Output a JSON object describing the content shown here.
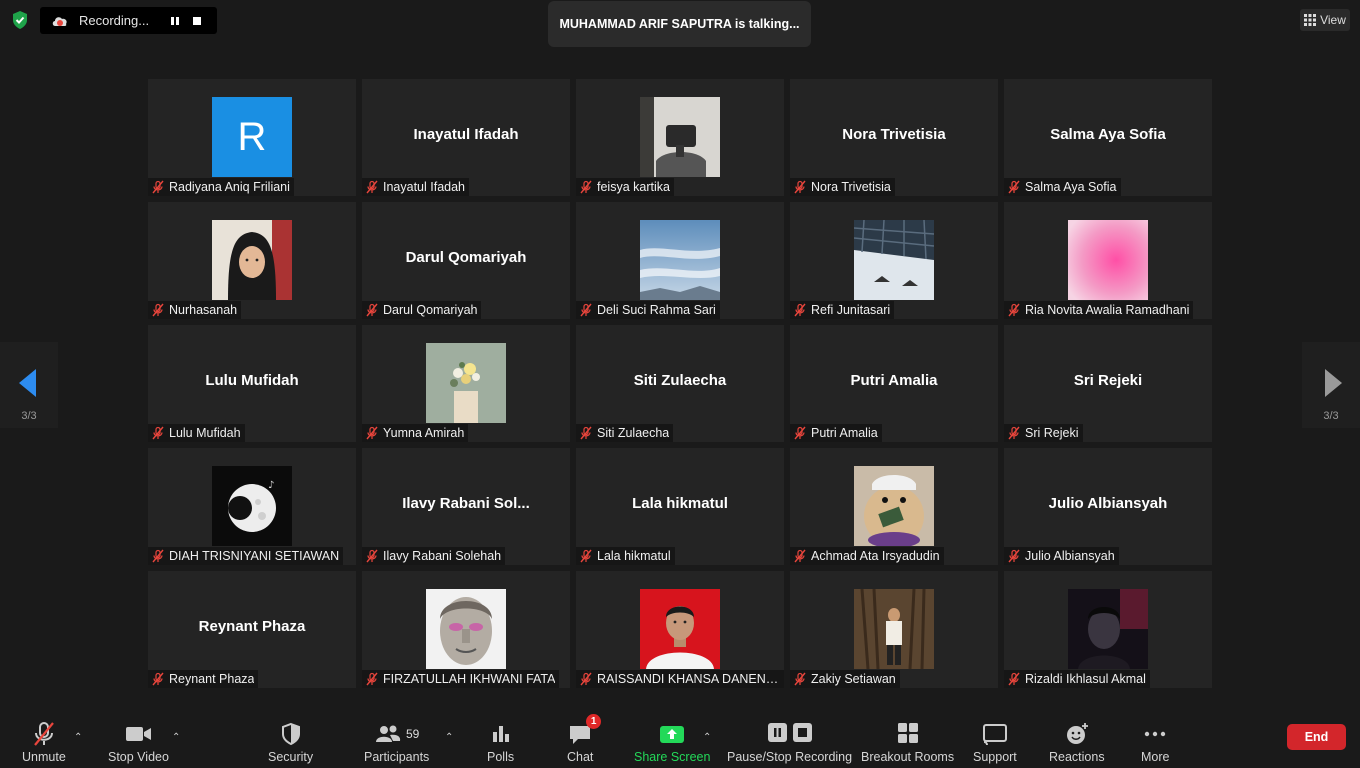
{
  "recording": {
    "label": "Recording..."
  },
  "talking_banner": "MUHAMMAD ARIF SAPUTRA is talking...",
  "view_button": "View",
  "pagination": {
    "left": "3/3",
    "right": "3/3"
  },
  "participants": [
    {
      "name": "Radiyana Aniq Friliani",
      "display": "",
      "avatar": "letter",
      "letter": "R",
      "color": "#1a8fe3"
    },
    {
      "name": "Inayatul Ifadah",
      "display": "Inayatul Ifadah"
    },
    {
      "name": "feisya kartika",
      "display": "",
      "avatar": "photo",
      "scene": "chair"
    },
    {
      "name": "Nora Trivetisia",
      "display": "Nora Trivetisia"
    },
    {
      "name": "Salma Aya Sofia",
      "display": "Salma Aya Sofia"
    },
    {
      "name": "Nurhasanah",
      "display": "",
      "avatar": "photo",
      "scene": "girl"
    },
    {
      "name": "Darul Qomariyah",
      "display": "Darul Qomariyah"
    },
    {
      "name": "Deli Suci Rahma Sari",
      "display": "",
      "avatar": "photo",
      "scene": "sky"
    },
    {
      "name": "Refi Junitasari",
      "display": "",
      "avatar": "photo",
      "scene": "ceiling"
    },
    {
      "name": "Ria Novita Awalia Ramadhani",
      "display": "",
      "avatar": "photo",
      "scene": "pink"
    },
    {
      "name": "Lulu Mufidah",
      "display": "Lulu Mufidah"
    },
    {
      "name": "Yumna Amirah",
      "display": "",
      "avatar": "photo",
      "scene": "flowers"
    },
    {
      "name": "Siti Zulaecha",
      "display": "Siti Zulaecha"
    },
    {
      "name": "Putri Amalia",
      "display": "Putri Amalia"
    },
    {
      "name": "Sri Rejeki",
      "display": "Sri Rejeki"
    },
    {
      "name": "DIAH TRISNIYANI SETIAWAN",
      "display": "",
      "avatar": "photo",
      "scene": "moon"
    },
    {
      "name": "Ilavy Rabani Solehah",
      "display": "Ilavy  Rabani  Sol..."
    },
    {
      "name": "Lala hikmatul",
      "display": "Lala hikmatul"
    },
    {
      "name": "Achmad Ata Irsyadudin",
      "display": "",
      "avatar": "photo",
      "scene": "hamster"
    },
    {
      "name": "Julio Albiansyah",
      "display": "Julio Albiansyah"
    },
    {
      "name": "Reynant Phaza",
      "display": "Reynant Phaza"
    },
    {
      "name": "FIRZATULLAH IKHWANI FATA",
      "display": "",
      "avatar": "photo",
      "scene": "statue"
    },
    {
      "name": "RAISSANDI KHANSA DANEND...",
      "display": "",
      "avatar": "photo",
      "scene": "portrait"
    },
    {
      "name": "Zakiy Setiawan",
      "display": "",
      "avatar": "photo",
      "scene": "tree"
    },
    {
      "name": "Rizaldi Ikhlasul Akmal",
      "display": "",
      "avatar": "photo",
      "scene": "dark"
    }
  ],
  "toolbar": {
    "unmute": "Unmute",
    "stop_video": "Stop Video",
    "security": "Security",
    "participants": "Participants",
    "participants_count": "59",
    "polls": "Polls",
    "chat": "Chat",
    "chat_badge": "1",
    "share_screen": "Share Screen",
    "pause_stop_recording": "Pause/Stop Recording",
    "breakout_rooms": "Breakout Rooms",
    "support": "Support",
    "reactions": "Reactions",
    "more": "More",
    "end": "End"
  },
  "colors": {
    "share_green": "#23d959",
    "end_red": "#d3262b",
    "mute_red": "#e8453c",
    "accent_blue": "#1a8fe3"
  }
}
